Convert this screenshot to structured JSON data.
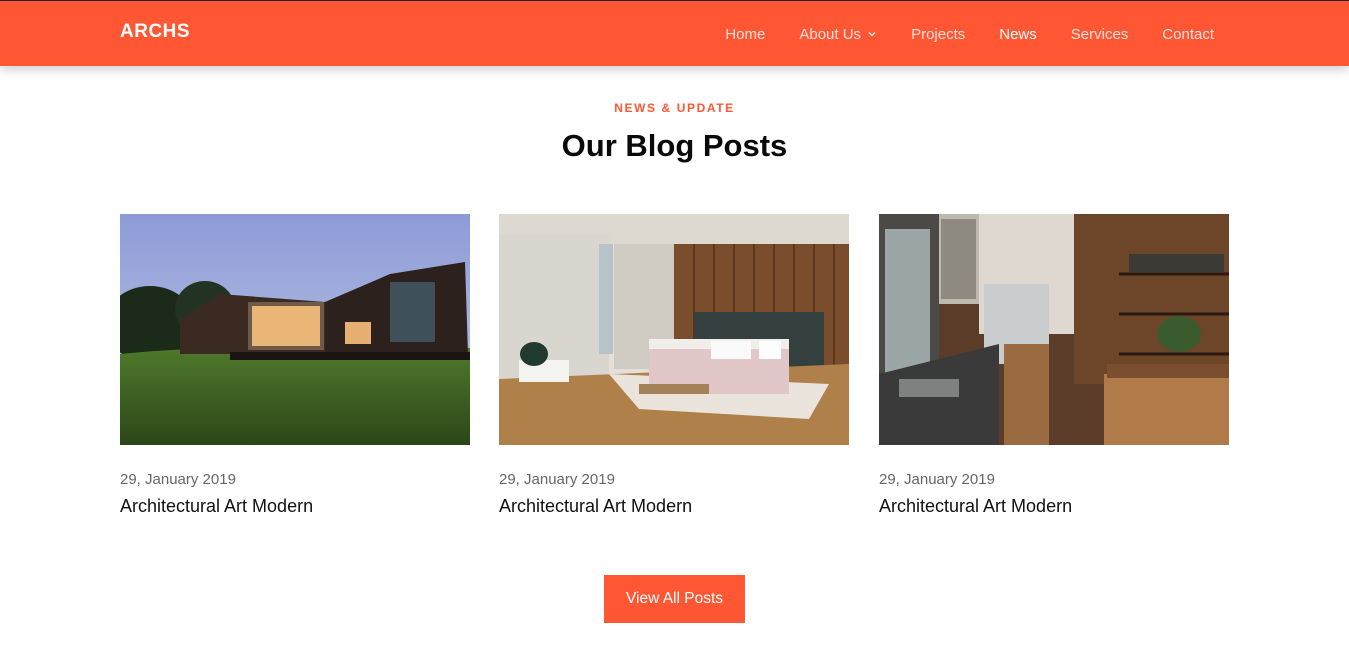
{
  "header": {
    "brand": "ARCHS",
    "nav": [
      {
        "label": "Home"
      },
      {
        "label": "About Us"
      },
      {
        "label": "Projects"
      },
      {
        "label": "News"
      },
      {
        "label": "Services"
      },
      {
        "label": "Contact"
      }
    ]
  },
  "section": {
    "eyebrow": "NEWS & UPDATE",
    "title": "Our Blog Posts"
  },
  "posts": [
    {
      "date": "29, January 2019",
      "title": "Architectural Art Modern"
    },
    {
      "date": "29, January 2019",
      "title": "Architectural Art Modern"
    },
    {
      "date": "29, January 2019",
      "title": "Architectural Art Modern"
    }
  ],
  "cta": {
    "label": "View All Posts"
  },
  "colors": {
    "accent": "#ff5733"
  }
}
